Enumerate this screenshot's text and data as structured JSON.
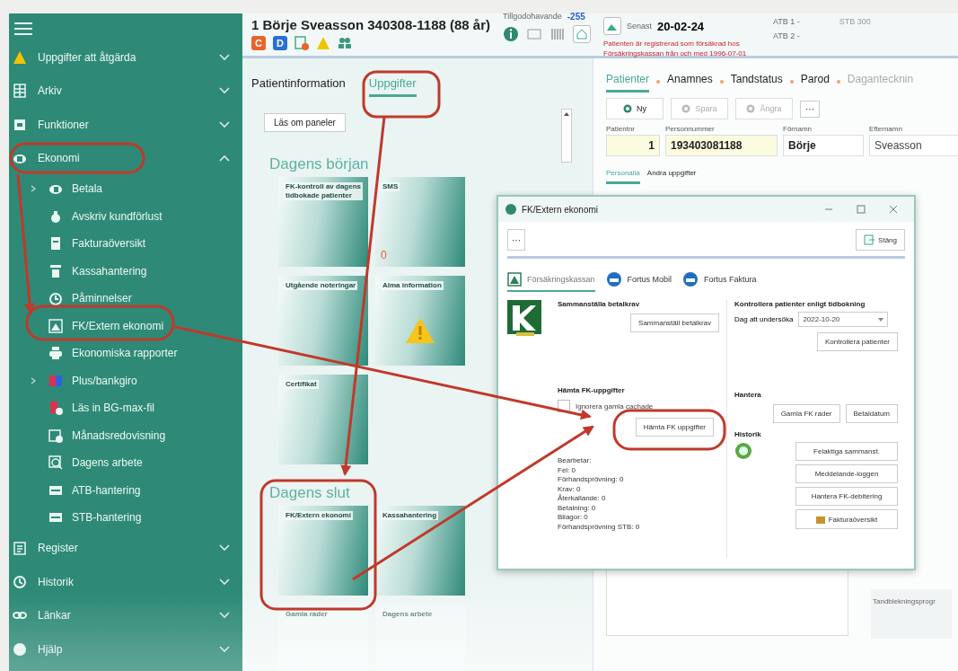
{
  "sidebar": {
    "items": [
      {
        "label": "Uppgifter att åtgärda",
        "expanded": false
      },
      {
        "label": "Arkiv",
        "expanded": false
      },
      {
        "label": "Funktioner",
        "expanded": false
      },
      {
        "label": "Ekonomi",
        "expanded": true,
        "children": [
          {
            "label": "Betala",
            "expandable": true
          },
          {
            "label": "Avskriv kundförlust",
            "expandable": false
          },
          {
            "label": "Fakturaöversikt",
            "expandable": false
          },
          {
            "label": "Kassahantering",
            "expandable": false
          },
          {
            "label": "Påminnelser",
            "expandable": false
          },
          {
            "label": "FK/Extern ekonomi",
            "expandable": false
          },
          {
            "label": "Ekonomiska rapporter",
            "expandable": false
          },
          {
            "label": "Plus/bankgiro",
            "expandable": true
          },
          {
            "label": "Läs in BG-max-fil",
            "expandable": false
          },
          {
            "label": "Månadsredovisning",
            "expandable": false
          },
          {
            "label": "Dagens arbete",
            "expandable": false
          },
          {
            "label": "ATB-hantering",
            "expandable": false
          },
          {
            "label": "STB-hantering",
            "expandable": false
          }
        ]
      },
      {
        "label": "Register",
        "expanded": false
      },
      {
        "label": "Historik",
        "expanded": false
      },
      {
        "label": "Länkar",
        "expanded": false
      },
      {
        "label": "Hjälp",
        "expanded": false
      }
    ]
  },
  "header": {
    "patient": "1 Börje Sveasson 340308-1188 (88 år)",
    "badges": [
      {
        "letter": "C",
        "color": "#e8632b"
      },
      {
        "letter": "D",
        "color": "#2a6fd6"
      }
    ],
    "balance_label": "Tillgodohavande",
    "balance": "-255",
    "last_label": "Senast",
    "last_date": "20-02-24",
    "notice": "Patienten är registrerad som försäkrad hos Försäkringskassan från och med 1996-07-01",
    "atb": [
      "ATB 1 -",
      "ATB 2 -"
    ],
    "stb": "STB 300"
  },
  "left_panel": {
    "tabs": [
      {
        "label": "Patientinformation",
        "selected": false
      },
      {
        "label": "Uppgifter",
        "selected": true
      }
    ],
    "reload_button": "Läs om paneler",
    "sections": [
      {
        "title": "Dagens början",
        "tiles": [
          {
            "title": "FK-kontroll av dagens tidbokade patienter",
            "kind": "plain"
          },
          {
            "title": "SMS",
            "kind": "count",
            "count": "0"
          },
          {
            "title": "Utgående noteringar",
            "kind": "plain"
          },
          {
            "title": "Alma information",
            "kind": "warning"
          },
          {
            "title": "Certifikat",
            "kind": "plain"
          }
        ]
      },
      {
        "title": "Dagens slut",
        "tiles": [
          {
            "title": "FK/Extern ekonomi",
            "kind": "plain"
          },
          {
            "title": "Kassahantering",
            "kind": "plain"
          },
          {
            "title": "Gamla rader",
            "kind": "faded"
          },
          {
            "title": "Dagens arbete",
            "kind": "faded"
          }
        ]
      }
    ]
  },
  "right_panel": {
    "tabs": [
      {
        "label": "Patienter",
        "selected": true
      },
      {
        "label": "Anamnes",
        "selected": false
      },
      {
        "label": "Tandstatus",
        "selected": false
      },
      {
        "label": "Parod",
        "selected": false
      },
      {
        "label": "Dagantecknin",
        "selected": false
      }
    ],
    "toolbar": [
      {
        "label": "Ny",
        "disabled": false
      },
      {
        "label": "Spara",
        "disabled": true
      },
      {
        "label": "Ångra",
        "disabled": true
      }
    ],
    "more": "···",
    "fields": [
      {
        "label": "Patientnr",
        "value": "1"
      },
      {
        "label": "Personnummer",
        "value": "193403081188"
      },
      {
        "label": "Förnamn",
        "value": "Börje"
      },
      {
        "label": "Efternamn",
        "value": "Sveasson"
      }
    ],
    "subtabs": [
      {
        "label": "Personalia",
        "selected": true
      },
      {
        "label": "Andra uppgifter",
        "selected": false
      }
    ],
    "side_label": "Tandblekningsprogr"
  },
  "dialog": {
    "title": "FK/Extern ekonomi",
    "more": "···",
    "close_button": "Stäng",
    "tabs": [
      {
        "label": "Försäkringskassan",
        "selected": true
      },
      {
        "label": "Fortus Mobil",
        "selected": false
      },
      {
        "label": "Fortus Faktura",
        "selected": false
      }
    ],
    "summary": {
      "title": "Sammanställa betalkrav",
      "button": "Sammanställ betalkrav"
    },
    "fetch": {
      "title": "Hämta FK-uppgifter",
      "checkbox": {
        "label": "Ignorera gamla cachade",
        "checked": false
      },
      "button": "Hämta FK uppgifter",
      "status": [
        "Bearbetar:",
        "Fel: 0",
        "Förhandsprövning: 0",
        "Krav: 0",
        "Återkallande: 0",
        "Betalning: 0",
        "Bilagor: 0",
        "Förhandsprövning STB: 0"
      ]
    },
    "control": {
      "title": "Kontrollera patienter enligt tidbokning",
      "date_label": "Dag att undersöka",
      "date": "2022-10-20",
      "button": "Kontrollera patienter"
    },
    "manage": {
      "title": "Hantera",
      "buttons": [
        "Gamla FK rader",
        "Betaldatum"
      ]
    },
    "history": {
      "title": "Historik",
      "buttons": [
        "Felaktiga sammanst.",
        "Meddelande-loggen",
        "Hantera FK-debitering",
        "Fakturaöversikt"
      ]
    }
  }
}
